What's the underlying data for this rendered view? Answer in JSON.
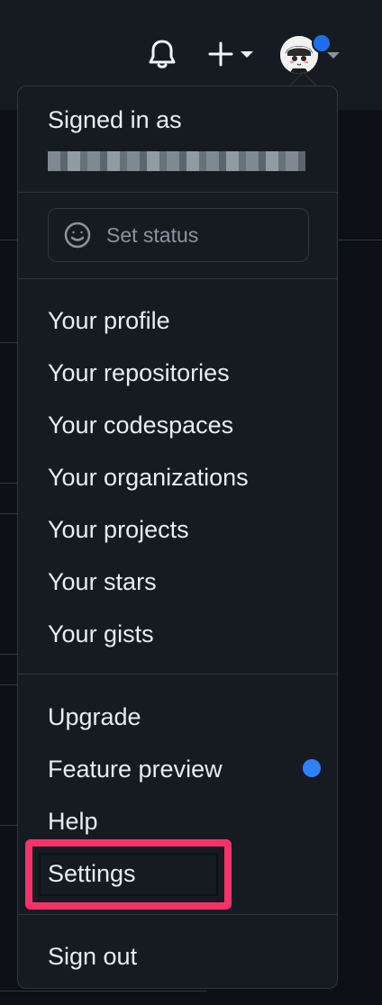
{
  "header": {
    "notifications_icon": "bell-icon",
    "create_icon": "plus-icon",
    "avatar_icon": "avatar-icon",
    "unread_indicator_color": "#1f6feb"
  },
  "menu": {
    "signed_in_label": "Signed in as",
    "set_status_label": "Set status",
    "items": [
      {
        "label": "Your profile"
      },
      {
        "label": "Your repositories"
      },
      {
        "label": "Your codespaces"
      },
      {
        "label": "Your organizations"
      },
      {
        "label": "Your projects"
      },
      {
        "label": "Your stars"
      },
      {
        "label": "Your gists"
      }
    ],
    "secondary": [
      {
        "label": "Upgrade"
      },
      {
        "label": "Feature preview"
      },
      {
        "label": "Help"
      },
      {
        "label": "Settings"
      }
    ],
    "sign_out_label": "Sign out"
  },
  "colors": {
    "background": "#0d1117",
    "panel": "#161b22",
    "border": "#30363d",
    "text": "#e6edf3",
    "muted": "#8b949e",
    "accent_blue": "#2f81f7",
    "highlight": "#f7326a"
  }
}
